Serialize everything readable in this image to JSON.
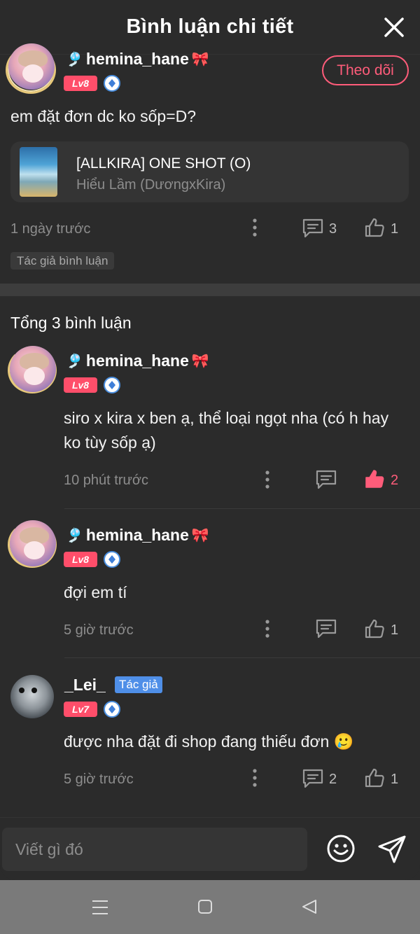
{
  "header": {
    "title": "Bình luận chi tiết"
  },
  "main_comment": {
    "username": "hemina_hane",
    "level": "Lv8",
    "follow_label": "Theo dõi",
    "text": "em đặt đơn dc ko sốp=D?",
    "book": {
      "title": "[ALLKIRA] ONE SHOT (O)",
      "subtitle": "Hiểu Lầm (DươngxKira)"
    },
    "time": "1 ngày trước",
    "reply_count": "3",
    "like_count": "1",
    "tag": "Tác giả bình luận"
  },
  "replies_title": "Tổng 3 bình luận",
  "replies": [
    {
      "username": "hemina_hane",
      "level": "Lv8",
      "text_line1": "siro x kira x ben ạ, thể loại ngọt nha (có h hay",
      "text_line2": "ko tùy sốp ạ)",
      "time": "10 phút trước",
      "like_count": "2"
    },
    {
      "username": "hemina_hane",
      "level": "Lv8",
      "text": "đợi em tí",
      "time": "5 giờ trước",
      "like_count": "1"
    },
    {
      "username": "_Lei_",
      "level": "Lv7",
      "author_tag": "Tác giả",
      "text": "được nha đặt đi shop đang thiếu đơn 🥲",
      "time": "5 giờ trước",
      "reply_count": "2",
      "like_count": "1"
    }
  ],
  "input": {
    "placeholder": "Viết gì đó"
  },
  "colors": {
    "accent": "#ff5c7a",
    "level_badge": "#ff4e6a",
    "author_tag": "#4f8fe8",
    "background": "#2b2b2b"
  },
  "icons": [
    "close-icon",
    "more-icon",
    "comment-icon",
    "like-icon",
    "emoji-icon",
    "send-icon",
    "menu-icon",
    "home-icon",
    "back-icon"
  ]
}
